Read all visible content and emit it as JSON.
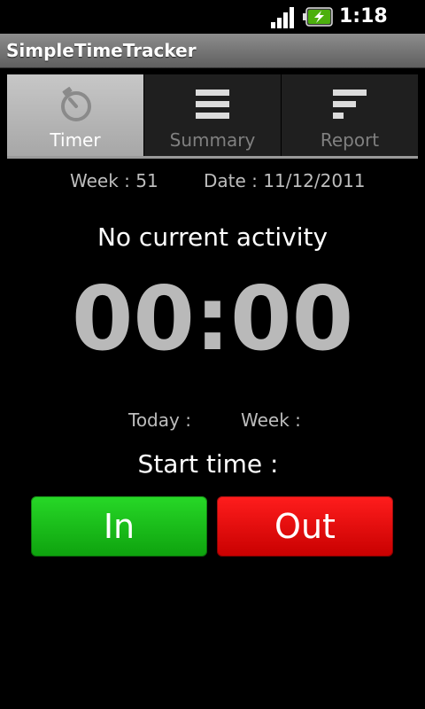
{
  "status_bar": {
    "time": "1:18 PM",
    "icons": [
      "signal-icon",
      "battery-charging-icon"
    ]
  },
  "app": {
    "title": "SimpleTimeTracker"
  },
  "tabs": [
    {
      "label": "Timer",
      "icon": "stopwatch-icon",
      "selected": true
    },
    {
      "label": "Summary",
      "icon": "list-icon",
      "selected": false
    },
    {
      "label": "Report",
      "icon": "bar-chart-icon",
      "selected": false
    }
  ],
  "info": {
    "week": "Week : 51",
    "date": "Date : 11/12/2011"
  },
  "activity_text": "No current activity",
  "timer": "00:00",
  "totals": {
    "today_label": "Today :",
    "week_label": "Week :"
  },
  "start_time_label": "Start time :",
  "buttons": {
    "in": "In",
    "out": "Out"
  },
  "colors": {
    "in_button": "#12b012",
    "out_button": "#e00000",
    "timer_text": "#b9b9b9"
  }
}
